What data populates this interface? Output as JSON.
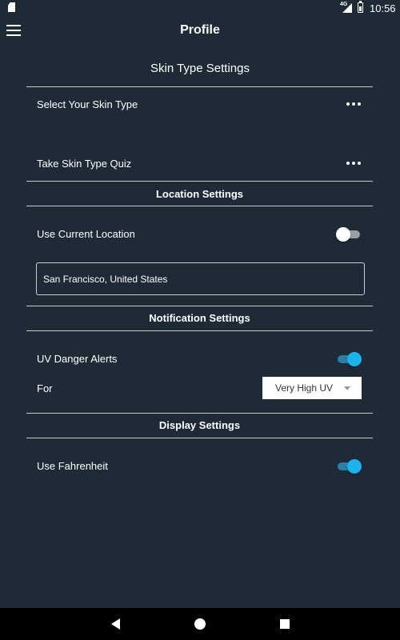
{
  "status_bar": {
    "time": "10:56",
    "network": "4G"
  },
  "app_bar": {
    "title": "Profile"
  },
  "skin": {
    "title": "Skin Type Settings",
    "select_label": "Select Your Skin Type",
    "quiz_label": "Take Skin Type Quiz"
  },
  "location": {
    "title": "Location Settings",
    "use_current_label": "Use Current Location",
    "use_current_enabled": false,
    "value": "San Francisco, United States"
  },
  "notifications": {
    "title": "Notification Settings",
    "uv_alerts_label": "UV Danger Alerts",
    "uv_alerts_enabled": true,
    "for_label": "For",
    "uv_level_selected": "Very High UV"
  },
  "display": {
    "title": "Display Settings",
    "fahrenheit_label": "Use Fahrenheit",
    "fahrenheit_enabled": true
  },
  "colors": {
    "background": "#1e2a36",
    "accent": "#1ab3ec",
    "divider": "#c9ced3"
  },
  "icons": {
    "menu": "hamburger-menu-icon",
    "more": "more-horizontal-icon",
    "back": "triangle-back-icon",
    "home": "circle-home-icon",
    "recents": "square-recents-icon"
  }
}
